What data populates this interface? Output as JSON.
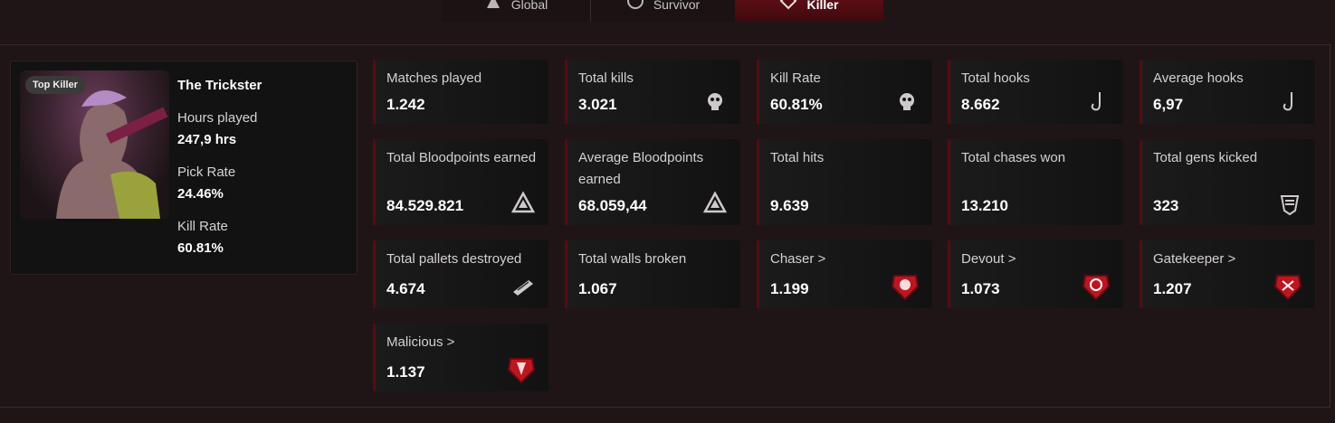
{
  "tabs": [
    {
      "label": "Global",
      "icon": "global-icon"
    },
    {
      "label": "Survivor",
      "icon": "survivor-icon"
    },
    {
      "label": "Killer",
      "icon": "killer-icon",
      "active": true
    }
  ],
  "killer": {
    "badge": "Top Killer",
    "name": "The Trickster",
    "hours_label": "Hours played",
    "hours_value": "247,9 hrs",
    "pick_label": "Pick Rate",
    "pick_value": "24.46%",
    "kill_label": "Kill Rate",
    "kill_value": "60.81%"
  },
  "stats": [
    {
      "label": "Matches played",
      "value": "1.242",
      "icon": ""
    },
    {
      "label": "Total kills",
      "value": "3.021",
      "icon": "skull-icon"
    },
    {
      "label": "Kill Rate",
      "value": "60.81%",
      "icon": "skull-icon"
    },
    {
      "label": "Total hooks",
      "value": "8.662",
      "icon": "hook-icon"
    },
    {
      "label": "Average hooks",
      "value": "6,97",
      "icon": "hook-icon"
    },
    {
      "label": "Total Bloodpoints earned",
      "value": "84.529.821",
      "icon": "bloodpoints-icon"
    },
    {
      "label": "Average Bloodpoints earned",
      "value": "68.059,44",
      "icon": "bloodpoints-icon"
    },
    {
      "label": "Total hits",
      "value": "9.639",
      "icon": ""
    },
    {
      "label": "Total chases won",
      "value": "13.210",
      "icon": ""
    },
    {
      "label": "Total gens kicked",
      "value": "323",
      "icon": "generator-icon"
    },
    {
      "label": "Total pallets destroyed",
      "value": "4.674",
      "icon": "pallet-icon"
    },
    {
      "label": "Total walls broken",
      "value": "1.067",
      "icon": ""
    },
    {
      "label": "Chaser >",
      "value": "1.199",
      "icon": "chaser-emblem-icon"
    },
    {
      "label": "Devout >",
      "value": "1.073",
      "icon": "devout-emblem-icon"
    },
    {
      "label": "Gatekeeper >",
      "value": "1.207",
      "icon": "gatekeeper-emblem-icon"
    },
    {
      "label": "Malicious >",
      "value": "1.137",
      "icon": "malicious-emblem-icon"
    }
  ],
  "colors": {
    "accent": "#5a0a10",
    "emblem": "#c0151f",
    "background": "#1f1516"
  }
}
